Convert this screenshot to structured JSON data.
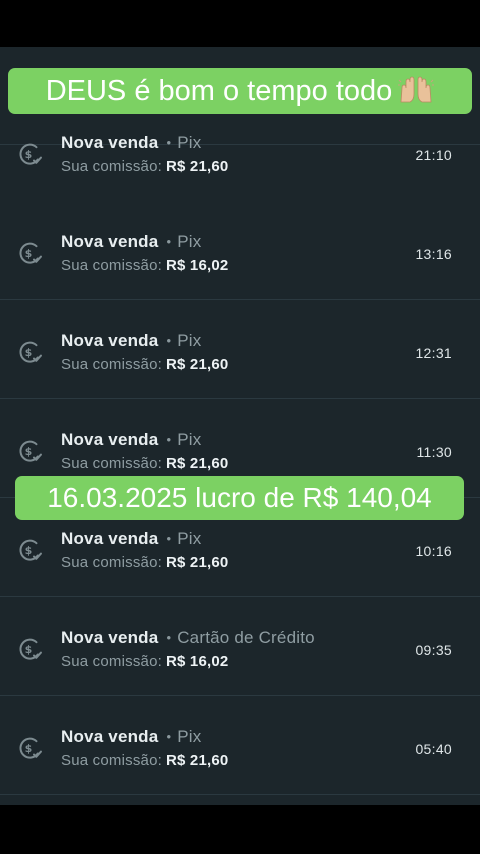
{
  "overlays": {
    "top_caption": "DEUS é bom o tempo todo",
    "top_emoji": "raised-hands-emoji",
    "middle_caption": "16.03.2025 lucro de R$ 140,04",
    "banner_color": "#7cd163"
  },
  "sales": [
    {
      "title": "Nova venda",
      "separator": "•",
      "method": "Pix",
      "commission_label": "Sua comissão:",
      "commission_value": "R$ 21,60",
      "time": "21:10"
    },
    {
      "title": "Nova venda",
      "separator": "•",
      "method": "Pix",
      "commission_label": "Sua comissão:",
      "commission_value": "R$ 16,02",
      "time": "13:16"
    },
    {
      "title": "Nova venda",
      "separator": "•",
      "method": "Pix",
      "commission_label": "Sua comissão:",
      "commission_value": "R$ 21,60",
      "time": "12:31"
    },
    {
      "title": "Nova venda",
      "separator": "•",
      "method": "Pix",
      "commission_label": "Sua comissão:",
      "commission_value": "R$ 21,60",
      "time": "11:30"
    },
    {
      "title": "Nova venda",
      "separator": "•",
      "method": "Pix",
      "commission_label": "Sua comissão:",
      "commission_value": "R$ 21,60",
      "time": "10:16"
    },
    {
      "title": "Nova venda",
      "separator": "•",
      "method": "Cartão de Crédito",
      "commission_label": "Sua comissão:",
      "commission_value": "R$ 16,02",
      "time": "09:35"
    },
    {
      "title": "Nova venda",
      "separator": "•",
      "method": "Pix",
      "commission_label": "Sua comissão:",
      "commission_value": "R$ 21,60",
      "time": "05:40"
    }
  ],
  "icons": {
    "sale_icon": "dollar-coin-check-icon"
  }
}
